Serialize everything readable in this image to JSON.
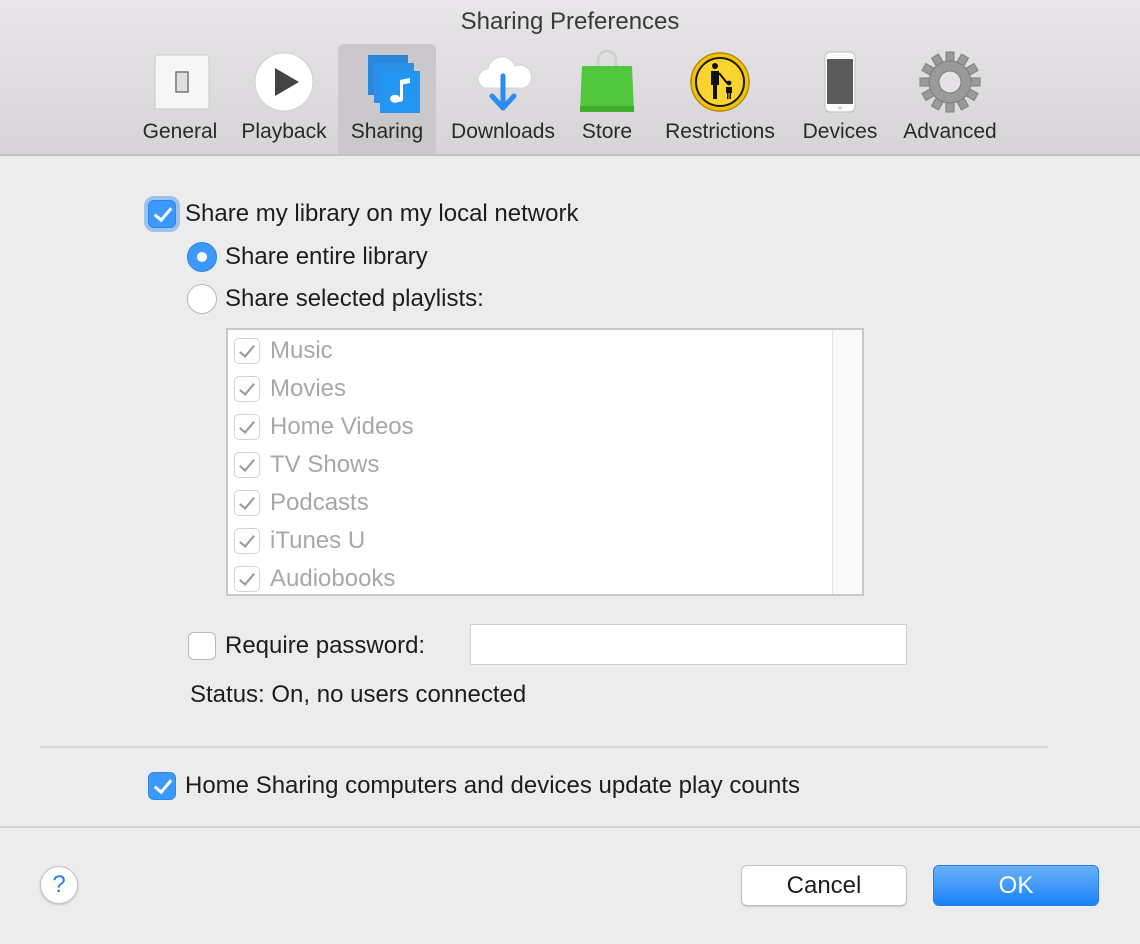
{
  "window": {
    "title": "Sharing Preferences"
  },
  "toolbar": {
    "tabs": [
      {
        "label": "General",
        "icon": "switch-icon",
        "selected": false
      },
      {
        "label": "Playback",
        "icon": "play-icon",
        "selected": false
      },
      {
        "label": "Sharing",
        "icon": "music-library-stack-icon",
        "selected": true
      },
      {
        "label": "Downloads",
        "icon": "cloud-download-icon",
        "selected": false
      },
      {
        "label": "Store",
        "icon": "shopping-bag-icon",
        "selected": false
      },
      {
        "label": "Restrictions",
        "icon": "parental-controls-icon",
        "selected": false
      },
      {
        "label": "Devices",
        "icon": "iphone-icon",
        "selected": false
      },
      {
        "label": "Advanced",
        "icon": "gear-icon",
        "selected": false
      }
    ]
  },
  "sharing": {
    "share_library": {
      "label": "Share my library on my local network",
      "checked": true
    },
    "share_entire": {
      "label": "Share entire library",
      "selected": true
    },
    "share_selected": {
      "label": "Share selected playlists:",
      "selected": false
    },
    "playlists": [
      {
        "label": "Music",
        "checked": true
      },
      {
        "label": "Movies",
        "checked": true
      },
      {
        "label": "Home Videos",
        "checked": true
      },
      {
        "label": "TV Shows",
        "checked": true
      },
      {
        "label": "Podcasts",
        "checked": true
      },
      {
        "label": "iTunes U",
        "checked": true
      },
      {
        "label": "Audiobooks",
        "checked": true
      }
    ],
    "require_password": {
      "label": "Require password:",
      "checked": false,
      "value": ""
    },
    "status": "Status: On, no users connected",
    "update_play_counts": {
      "label": "Home Sharing computers and devices update play counts",
      "checked": true
    }
  },
  "footer": {
    "help_label": "?",
    "cancel_label": "Cancel",
    "ok_label": "OK"
  },
  "colors": {
    "accent": "#3b99fc",
    "ok_button": "#1a82fb"
  }
}
